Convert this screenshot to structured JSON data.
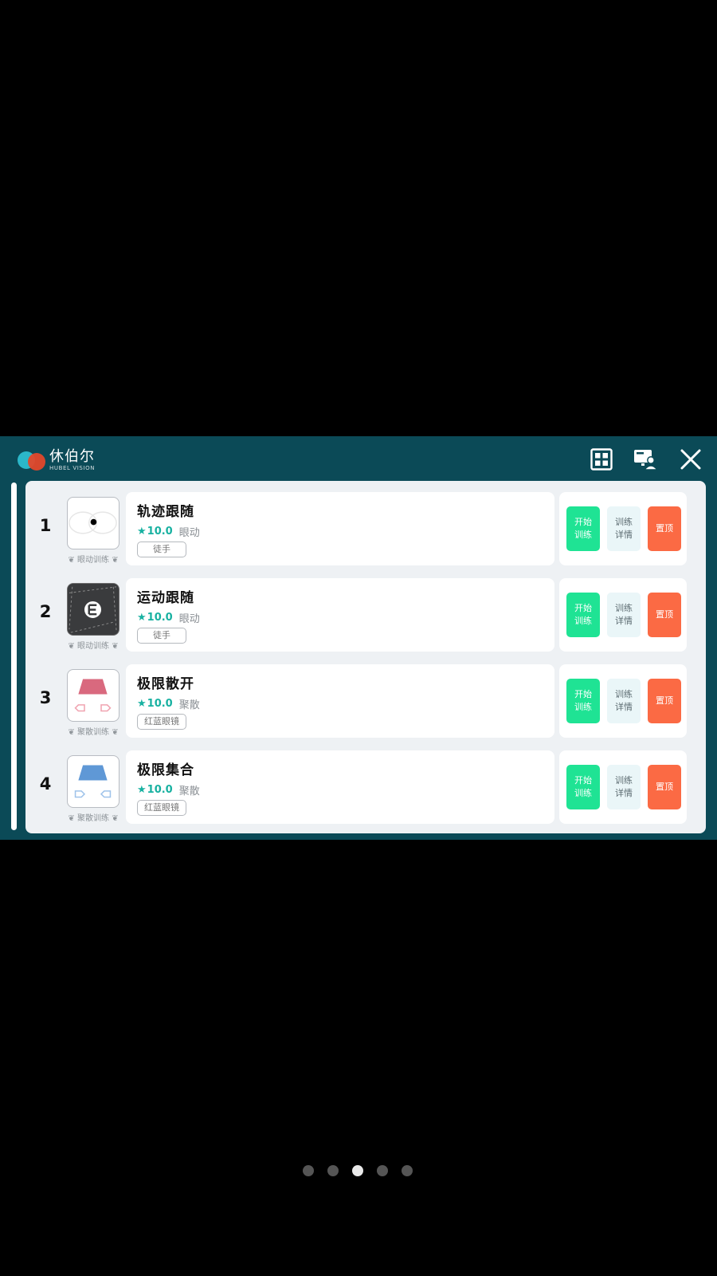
{
  "app": {
    "logo_zh": "休伯尔",
    "logo_en": "HUBEL VISION"
  },
  "header": {
    "grid_icon": "grid-icon",
    "monitor_user_icon": "monitor-user-icon",
    "close_icon": "close-icon"
  },
  "items": [
    {
      "index": "1",
      "title": "轨迹跟随",
      "score": "10.0",
      "type": "眼动",
      "tag": "徒手",
      "category": "眼动训练",
      "icon": "trajectory-icon"
    },
    {
      "index": "2",
      "title": "运动跟随",
      "score": "10.0",
      "type": "眼动",
      "tag": "徒手",
      "category": "眼动训练",
      "icon": "motion-e-icon"
    },
    {
      "index": "3",
      "title": "极限散开",
      "score": "10.0",
      "type": "聚散",
      "tag": "红蓝眼镜",
      "category": "聚散训练",
      "icon": "diverge-red-icon"
    },
    {
      "index": "4",
      "title": "极限集合",
      "score": "10.0",
      "type": "聚散",
      "tag": "红蓝眼镜",
      "category": "聚散训练",
      "icon": "converge-blue-icon"
    }
  ],
  "buttons": {
    "start_line1": "开始",
    "start_line2": "训练",
    "detail_line1": "训练",
    "detail_line2": "详情",
    "top": "置顶"
  },
  "colors": {
    "header_bg": "#0b4a57",
    "start_green": "#1fe394",
    "top_orange": "#fb6a44",
    "star_teal": "#18b1a1"
  },
  "pager": {
    "count": 5,
    "active": 3
  }
}
